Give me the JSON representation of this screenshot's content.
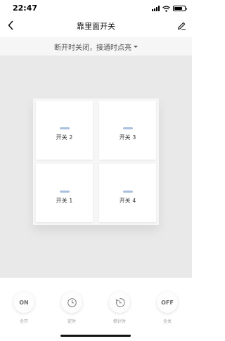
{
  "status_bar": {
    "time": "22:47",
    "signal_icon": "cellular-signal-icon",
    "wifi_icon": "wifi-icon",
    "battery_icon": "battery-icon",
    "battery_level": 0.8
  },
  "nav": {
    "title": "靠里面开关",
    "back_icon": "chevron-left-icon",
    "edit_icon": "pencil-icon"
  },
  "mode": {
    "label": "断开时关闭，接通时点亮",
    "caret_icon": "caret-down-icon"
  },
  "switches": [
    {
      "label": "开关 2"
    },
    {
      "label": "开关 3"
    },
    {
      "label": "开关 1"
    },
    {
      "label": "开关 4"
    }
  ],
  "actions": [
    {
      "label": "全开",
      "text": "ON",
      "icon": "on-text-icon"
    },
    {
      "label": "定时",
      "text": "",
      "icon": "clock-icon"
    },
    {
      "label": "倒计时",
      "text": "",
      "icon": "countdown-icon"
    },
    {
      "label": "全关",
      "text": "OFF",
      "icon": "off-text-icon"
    }
  ],
  "colors": {
    "indicator": "#a9c1de",
    "page_background": "#e9e9e9",
    "mode_bar": "#f6f6f6"
  }
}
